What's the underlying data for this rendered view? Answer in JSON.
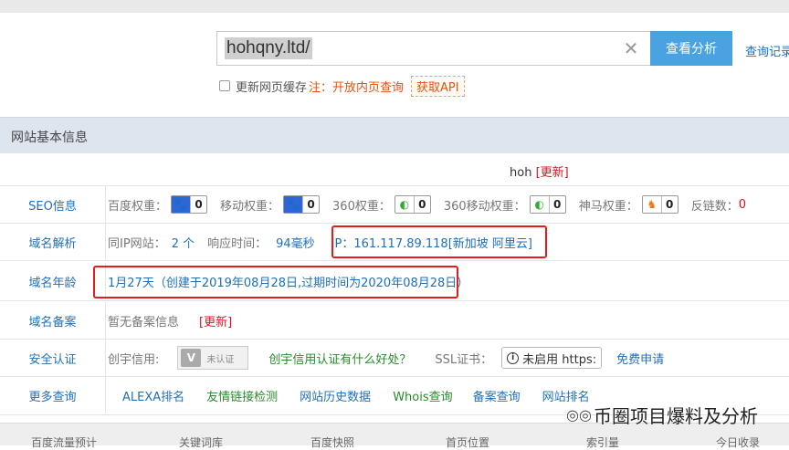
{
  "search": {
    "value": "hohqny.ltd/",
    "button": "查看分析",
    "history": "查询记录"
  },
  "options": {
    "checkbox_label": "更新网页缓存",
    "note": "注：开放内页查询",
    "api": "获取API"
  },
  "panel": {
    "title": "网站基本信息"
  },
  "site": {
    "title": "hoh",
    "refresh": "[更新]"
  },
  "seo": {
    "label": "SEO信息",
    "baidu_label": "百度权重：",
    "baidu_value": "0",
    "mobile_label": "移动权重：",
    "mobile_value": "0",
    "so_label": "360权重：",
    "so_value": "0",
    "so_mobile_label": "360移动权重：",
    "so_mobile_value": "0",
    "sm_label": "神马权重：",
    "sm_value": "0",
    "backlinks_label": "反链数：",
    "backlinks_value": "0"
  },
  "dns": {
    "label": "域名解析",
    "same_ip_label": "同IP网站：",
    "same_ip_value": "2 个",
    "response_label": "响应时间：",
    "response_value": "94毫秒",
    "ip": "IP：161.117.89.118[新加坡 阿里云]"
  },
  "age": {
    "label": "域名年龄",
    "value": "1月27天（创建于2019年08月28日,过期时间为2020年08月28日）"
  },
  "beian": {
    "label": "域名备案",
    "value": "暂无备案信息",
    "refresh": "[更新]"
  },
  "security": {
    "label": "安全认证",
    "cx_label": "创宇信用:",
    "cert_text": "未认证",
    "cx_link": "创宇信用认证有什么好处？",
    "ssl_label": "SSL证书：",
    "ssl_value": "未启用 https:",
    "ssl_link": "免费申请"
  },
  "more": {
    "label": "更多查询",
    "links": [
      "ALEXA排名",
      "友情链接检测",
      "网站历史数据",
      "Whois查询",
      "备案查询",
      "网站排名"
    ]
  },
  "bottom_tabs": [
    "百度流量预计",
    "关键词库",
    "百度快照",
    "首页位置",
    "索引量",
    "今日收录"
  ],
  "watermark": "币圈项目爆料及分析"
}
